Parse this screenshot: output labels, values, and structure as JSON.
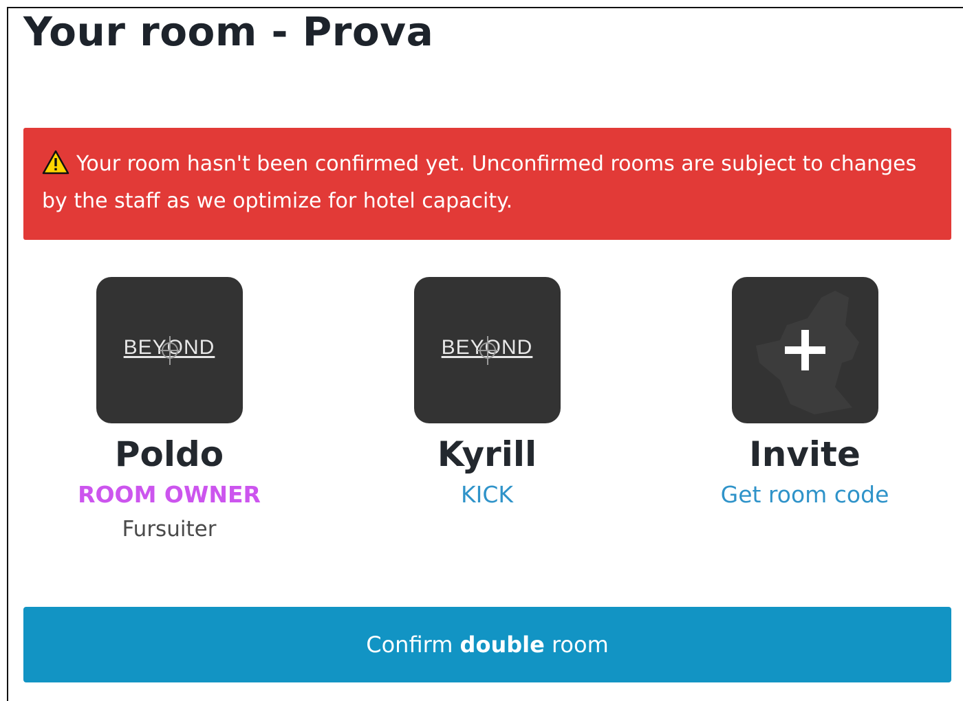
{
  "page": {
    "title": "Your room - Prova"
  },
  "alert": {
    "icon": "warning-icon",
    "message": "Your room hasn't been confirmed yet. Unconfirmed rooms are subject to changes by the staff as we optimize for hotel capacity.",
    "color": "#e23a37"
  },
  "members": [
    {
      "name": "Poldo",
      "avatar_text": "BEYOND",
      "role": "ROOM OWNER",
      "type": "Fursuiter"
    },
    {
      "name": "Kyrill",
      "avatar_text": "BEYOND",
      "action": "KICK"
    }
  ],
  "invite": {
    "name": "Invite",
    "icon": "plus-icon",
    "action": "Get room code"
  },
  "confirm": {
    "prefix": "Confirm ",
    "bold": "double",
    "suffix": " room",
    "color": "#1294c4"
  }
}
